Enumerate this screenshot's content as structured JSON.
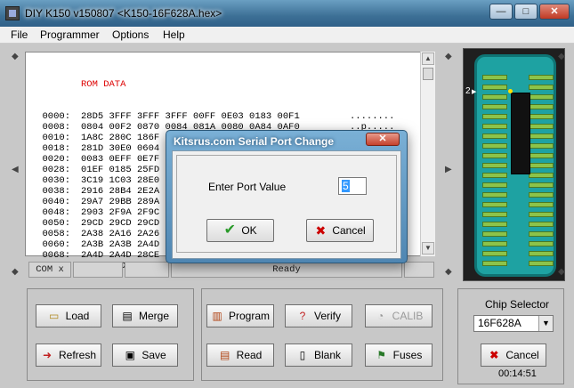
{
  "window": {
    "title": "DIY K150 v150807  <K150-16F628A.hex>",
    "minimize_glyph": "—",
    "maximize_glyph": "□",
    "close_glyph": "✕"
  },
  "menu": {
    "items": [
      "File",
      "Programmer",
      "Options",
      "Help"
    ]
  },
  "hex_view": {
    "header": "ROM DATA",
    "rows": [
      {
        "addr": "0000:",
        "words": "28D5 3FFF 3FFF 3FFF 00FF 0E03 0183 00F1",
        "ascii": "........"
      },
      {
        "addr": "0008:",
        "words": "0804 00F2 0870 0084 081A 0080 0A84 0AF0",
        "ascii": "..p....."
      },
      {
        "addr": "0010:",
        "words": "1A8C 280C 186F 2819 30C0 0604 1903 156F",
        "ascii": "....0..o"
      },
      {
        "addr": "0018:",
        "words": "281D 30E0 0604 1903 15EF 0872 0084 0E71",
        "ascii": ".....r.q"
      },
      {
        "addr": "0020:",
        "words": "0083 0EFF 0E7F 0009 3050 0099 01B5 01B6",
        "ascii": "..0P...."
      },
      {
        "addr": "0028:",
        "words": "01EF 0185 25FD",
        "ascii": ""
      },
      {
        "addr": "0030:",
        "words": "3C19 1C03 28E0",
        "ascii": ""
      },
      {
        "addr": "0038:",
        "words": "2916 28B4 2E2A",
        "ascii": ""
      },
      {
        "addr": "0040:",
        "words": "29A7 29BB 289A",
        "ascii": ""
      },
      {
        "addr": "0048:",
        "words": "2903 2F9A 2F9C",
        "ascii": ""
      },
      {
        "addr": "0050:",
        "words": "29CD 29CD 29CD",
        "ascii": ""
      },
      {
        "addr": "0058:",
        "words": "2A38 2A16 2A26",
        "ascii": ""
      },
      {
        "addr": "0060:",
        "words": "2A3B 2A3B 2A4D",
        "ascii": ""
      },
      {
        "addr": "0068:",
        "words": "2A4D 2A4D 28CE",
        "ascii": ""
      },
      {
        "addr": "0070:",
        "words": "2A56 2ADE 2AE0",
        "ascii": ""
      }
    ]
  },
  "status_bar": {
    "port": "COM x",
    "state": "Ready"
  },
  "buttons_left": {
    "load": "Load",
    "merge": "Merge",
    "refresh": "Refresh",
    "save": "Save"
  },
  "buttons_mid": {
    "program": "Program",
    "verify": "Verify",
    "calib": "CALIB",
    "read": "Read",
    "blank": "Blank",
    "fuses": "Fuses"
  },
  "chip_panel": {
    "pin_marker": "2",
    "selector_label": "Chip Selector",
    "selected_chip": "16F628A",
    "cancel_label": "Cancel",
    "timer": "00:14:51"
  },
  "dialog": {
    "title": "Kitsrus.com Serial Port Change",
    "close_glyph": "✕",
    "prompt": "Enter Port Value",
    "value": "5",
    "ok_label": "OK",
    "cancel_label": "Cancel",
    "ok_glyph": "✔",
    "cancel_glyph": "✖"
  },
  "colors": {
    "accent_red": "#cc0000",
    "ok_green": "#2a9a2a",
    "chip_board": "#1ea2a2",
    "pin_green": "#8cc34a"
  }
}
